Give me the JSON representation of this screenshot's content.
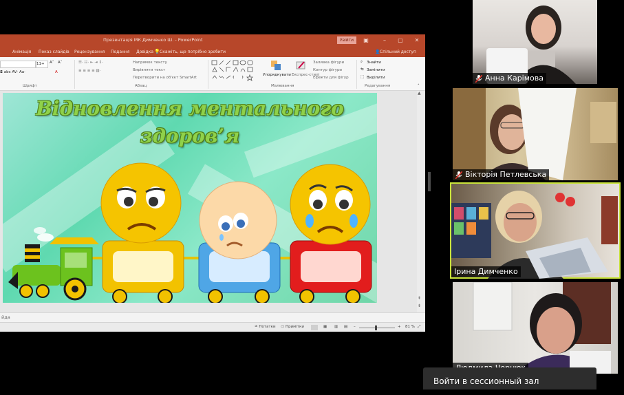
{
  "powerpoint": {
    "window_title": "Презентація МК Димченко Ш. - PowerPoint",
    "signin_label": "Увійти",
    "tabs": [
      "Анімація",
      "Показ слайдів",
      "Рецензування",
      "Подання",
      "Довідка"
    ],
    "tell_me": "Скажіть, що потрібно зробити",
    "share": "Спільний доступ",
    "ribbon": {
      "font_group_label": "Шрифт",
      "paragraph_group_label": "Абзац",
      "drawing_group_label": "Малювання",
      "editing_group_label": "Редагування",
      "font_size": "11+",
      "text_direction": "Напрямок тексту",
      "align_text": "Вирівняти текст",
      "convert_smartart": "Перетворити на об'єкт SmartArt",
      "arrange": "Упорядкувати",
      "quick_styles": "Експрес-стилі",
      "shape_fill": "Заливка фігури",
      "shape_outline": "Контур фігури",
      "shape_effects": "Ефекти для фігур",
      "find": "Знайти",
      "replace": "Замінити",
      "select": "Виділити"
    },
    "slide": {
      "title_line1": "Відновлення ментального",
      "title_line2": "здоров’я"
    },
    "notes_fragment": "йда",
    "status": {
      "notes": "Нотатки",
      "comments": "Примітки",
      "zoom": "81 %"
    }
  },
  "participants": [
    {
      "name": "Анна Карімова",
      "muted": true
    },
    {
      "name": "Вікторія Петлевська",
      "muted": true
    },
    {
      "name": "Ірина Димченко",
      "muted": false,
      "active_speaker": true
    },
    {
      "name": "Людмила Чорнюк",
      "muted": false
    }
  ],
  "session_popup": "Войти в сессионный зал",
  "colors": {
    "ppt_brand": "#b7472a",
    "active_speaker": "#c9e33a",
    "muted_icon": "#e0352b"
  }
}
